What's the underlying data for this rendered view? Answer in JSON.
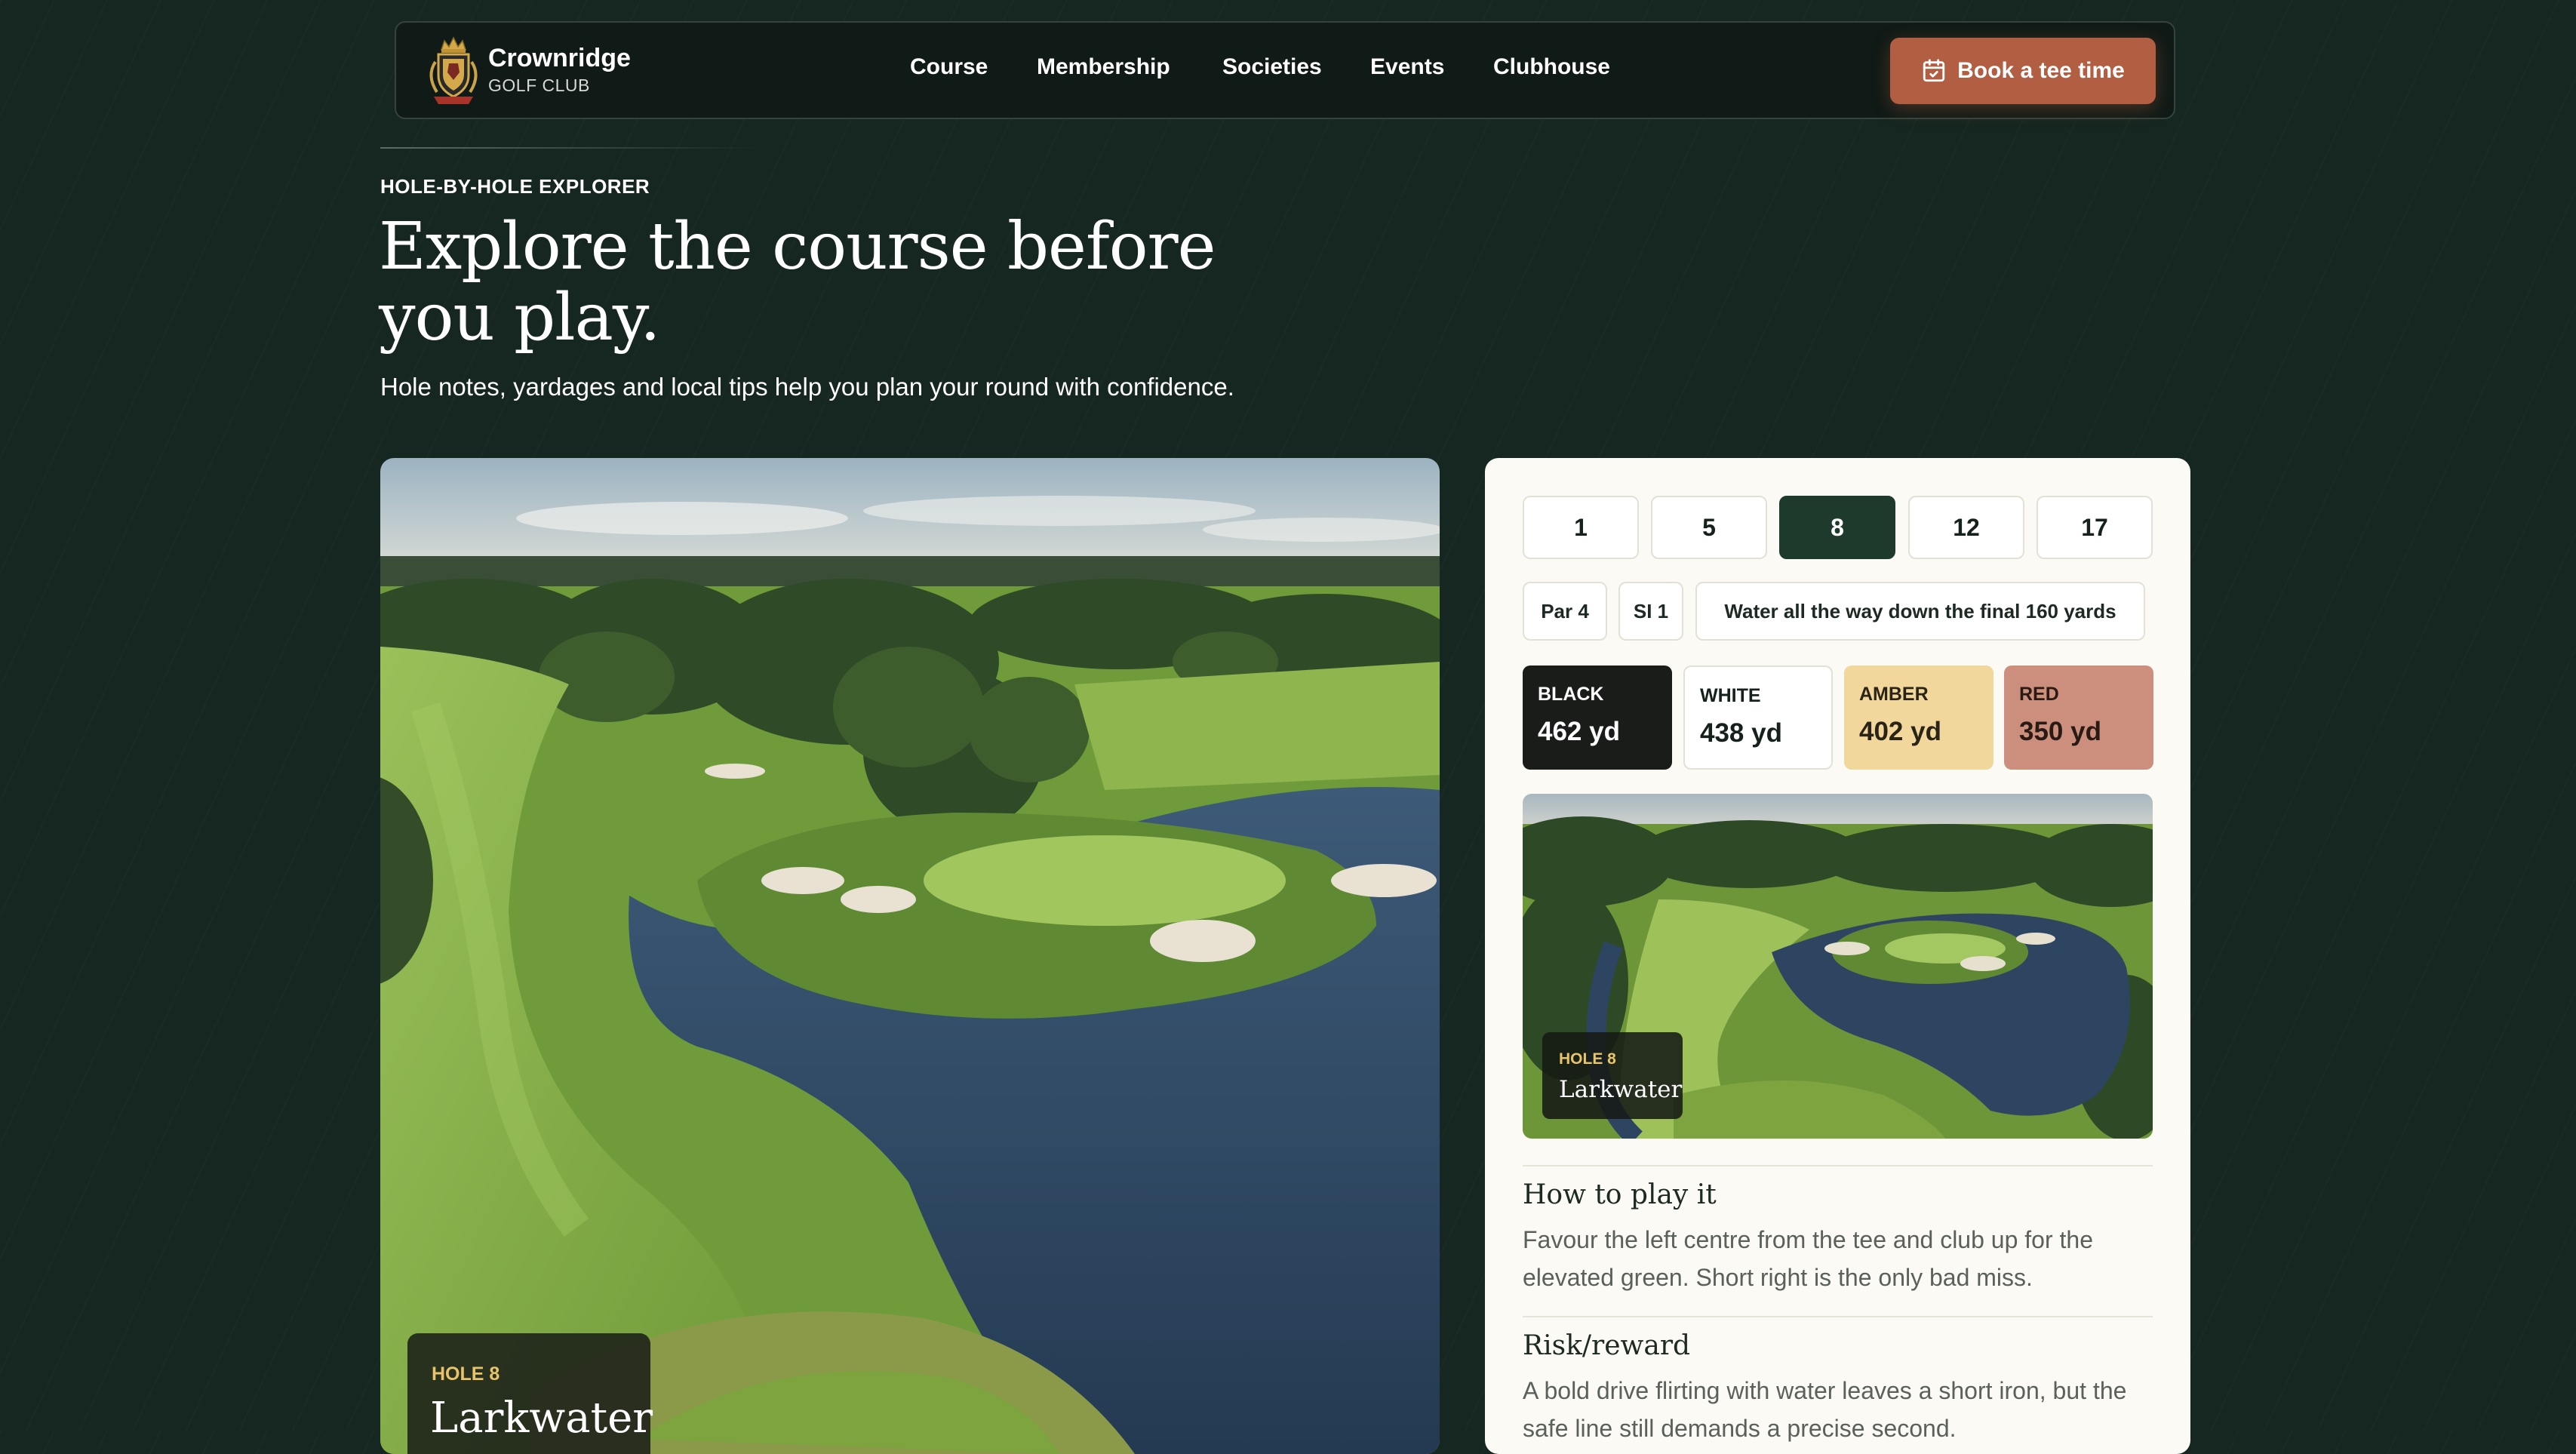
{
  "brand": {
    "name": "Crownridge",
    "sub": "GOLF CLUB"
  },
  "nav": {
    "items": [
      "Course",
      "Membership",
      "Societies",
      "Events",
      "Clubhouse"
    ],
    "cta_label": "Book a tee time"
  },
  "hero": {
    "eyebrow": "HOLE-BY-HOLE EXPLORER",
    "title": "Explore the course before you play.",
    "subtitle": "Hole notes, yardages and local tips help you plan your round with confidence."
  },
  "photo": {
    "hole_label": "HOLE 8",
    "hole_name": "Larkwater"
  },
  "panel": {
    "holes": [
      "1",
      "5",
      "8",
      "12",
      "17"
    ],
    "selected_hole": "8",
    "chips": {
      "par": "Par 4",
      "si": "SI 1",
      "note": "Water all the way down the final 160 yards"
    },
    "tees": [
      {
        "name": "BLACK",
        "yards": "462 yd"
      },
      {
        "name": "WHITE",
        "yards": "438 yd"
      },
      {
        "name": "AMBER",
        "yards": "402 yd"
      },
      {
        "name": "RED",
        "yards": "350 yd"
      }
    ],
    "mini": {
      "hole_label": "HOLE 8",
      "hole_name": "Larkwater"
    },
    "sections": [
      {
        "title": "How to play it",
        "text": "Favour the left centre from the tee and club up for the elevated green. Short right is the only bad miss."
      },
      {
        "title": "Risk/reward",
        "text": "A bold drive flirting with water leaves a short iron, but the safe line still demands a precise second."
      }
    ]
  },
  "colors": {
    "page_bg": "#162620",
    "nav_bg": "#101a16",
    "accent": "#b25e43",
    "selected": "#1d3a2c",
    "gold": "#e7c46a",
    "panel_bg": "#fbfaf4"
  },
  "icons": {
    "logo": "crest-logo-icon",
    "cta": "calendar-icon"
  }
}
